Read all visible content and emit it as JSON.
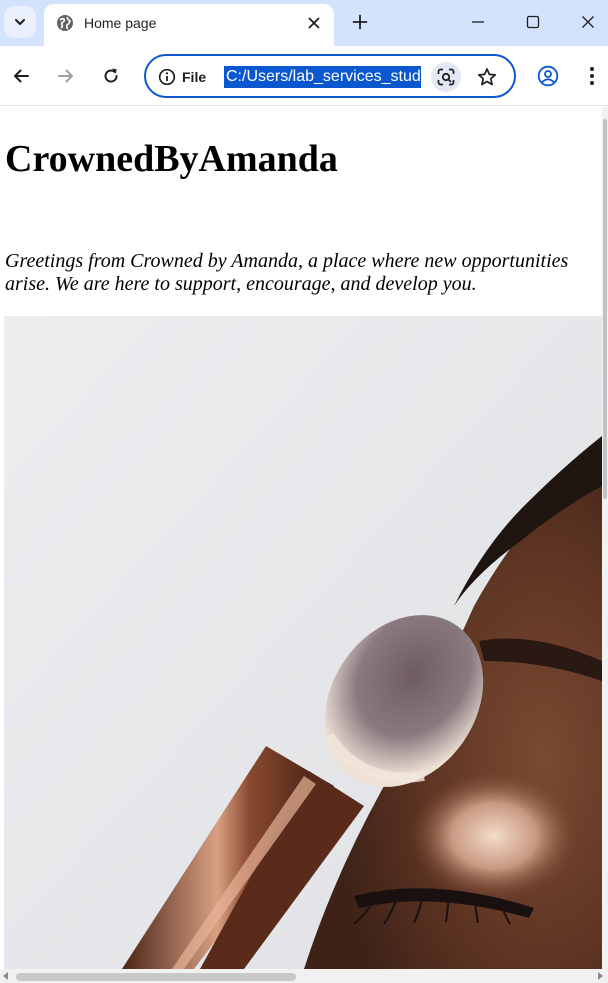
{
  "browser": {
    "tab_title": "Home page",
    "address_scheme_label": "File",
    "address_url": "C:/Users/lab_services_student/Desktop/index.html",
    "icons": {
      "tab_search": "chevron-down-icon",
      "favicon": "globe-icon",
      "tab_close": "close-icon",
      "new_tab": "plus-icon",
      "minimize": "minimize-icon",
      "maximize": "maximize-icon",
      "close_window": "close-icon",
      "back": "back-arrow-icon",
      "forward": "forward-arrow-icon",
      "reload": "reload-icon",
      "site_info": "info-icon",
      "lens": "lens-icon",
      "bookmark": "star-icon",
      "profile": "profile-icon",
      "menu": "kebab-menu-icon"
    },
    "colors": {
      "tabstrip": "#d3e3fd",
      "accent": "#0b57d0"
    }
  },
  "page": {
    "heading": "CrownedByAmanda",
    "intro": "Greetings from Crowned by Amanda, a place where new opportunities arise. We are here to support, encourage, and develop you."
  }
}
